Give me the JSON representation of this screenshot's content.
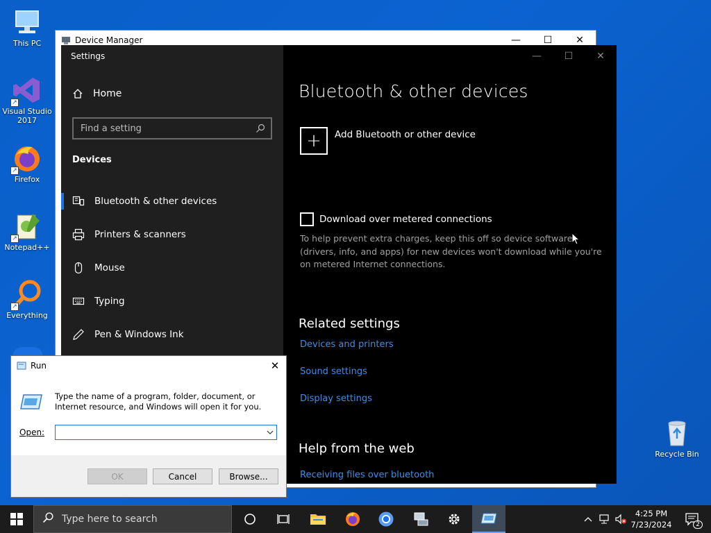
{
  "desktop": {
    "icons": [
      {
        "label": "This PC",
        "icon": "computer-icon"
      },
      {
        "label": "Visual Studio 2017",
        "icon": "visual-studio-icon"
      },
      {
        "label": "Firefox",
        "icon": "firefox-icon"
      },
      {
        "label": "Notepad++",
        "icon": "notepad-plus-plus-icon"
      },
      {
        "label": "Everything",
        "icon": "everything-search-icon"
      },
      {
        "label": "Recycle Bin",
        "icon": "recycle-bin-icon"
      }
    ]
  },
  "device_manager": {
    "title": "Device Manager"
  },
  "settings": {
    "title": "Settings",
    "home_label": "Home",
    "search_placeholder": "Find a setting",
    "section_label": "Devices",
    "nav": [
      {
        "label": "Bluetooth & other devices",
        "icon": "bluetooth-devices-icon",
        "active": true
      },
      {
        "label": "Printers & scanners",
        "icon": "printer-icon"
      },
      {
        "label": "Mouse",
        "icon": "mouse-icon"
      },
      {
        "label": "Typing",
        "icon": "keyboard-icon"
      },
      {
        "label": "Pen & Windows Ink",
        "icon": "pen-icon"
      }
    ],
    "page_title": "Bluetooth & other devices",
    "add_device_label": "Add Bluetooth or other device",
    "metered_label": "Download over metered connections",
    "metered_help": "To help prevent extra charges, keep this off so device software (drivers, info, and apps) for new devices won't download while you're on metered Internet connections.",
    "related_heading": "Related settings",
    "related_links": [
      "Devices and printers",
      "Sound settings",
      "Display settings"
    ],
    "help_heading": "Help from the web",
    "help_links": [
      "Receiving files over bluetooth"
    ]
  },
  "run_dialog": {
    "title": "Run",
    "description": "Type the name of a program, folder, document, or Internet resource, and Windows will open it for you.",
    "open_label": "Open:",
    "open_value": "",
    "ok_label": "OK",
    "cancel_label": "Cancel",
    "browse_label": "Browse..."
  },
  "taskbar": {
    "search_placeholder": "Type here to search",
    "time": "4:25 PM",
    "date": "7/23/2024",
    "notification_count": "2"
  },
  "colors": {
    "desktop_bg": "#0b63d1",
    "settings_sidebar": "#1f1f1f",
    "accent": "#1a73e8",
    "link": "#3b8eea",
    "taskbar": "#1c1c1c"
  }
}
